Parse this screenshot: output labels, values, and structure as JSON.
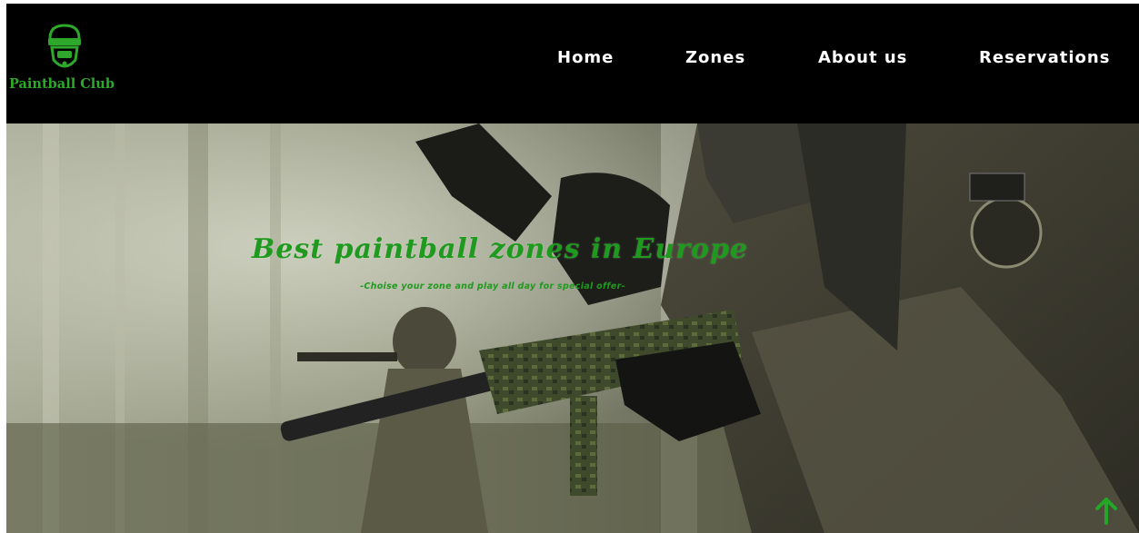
{
  "brand": {
    "name": "Paintball Club",
    "accent_color": "#2ea82a",
    "logo_icon": "paintball-mask-icon"
  },
  "nav": {
    "items": [
      {
        "label": "Home"
      },
      {
        "label": "Zones"
      },
      {
        "label": "About us"
      },
      {
        "label": "Reservations"
      }
    ]
  },
  "hero": {
    "title": "Best paintball zones in Europe",
    "subtitle": "-Choise your zone and play all day for special offer-",
    "title_color": "#1f9a1f",
    "background": "paintball-player-photo"
  },
  "scroll_top": {
    "icon": "arrow-up-icon",
    "color": "#22a826"
  }
}
